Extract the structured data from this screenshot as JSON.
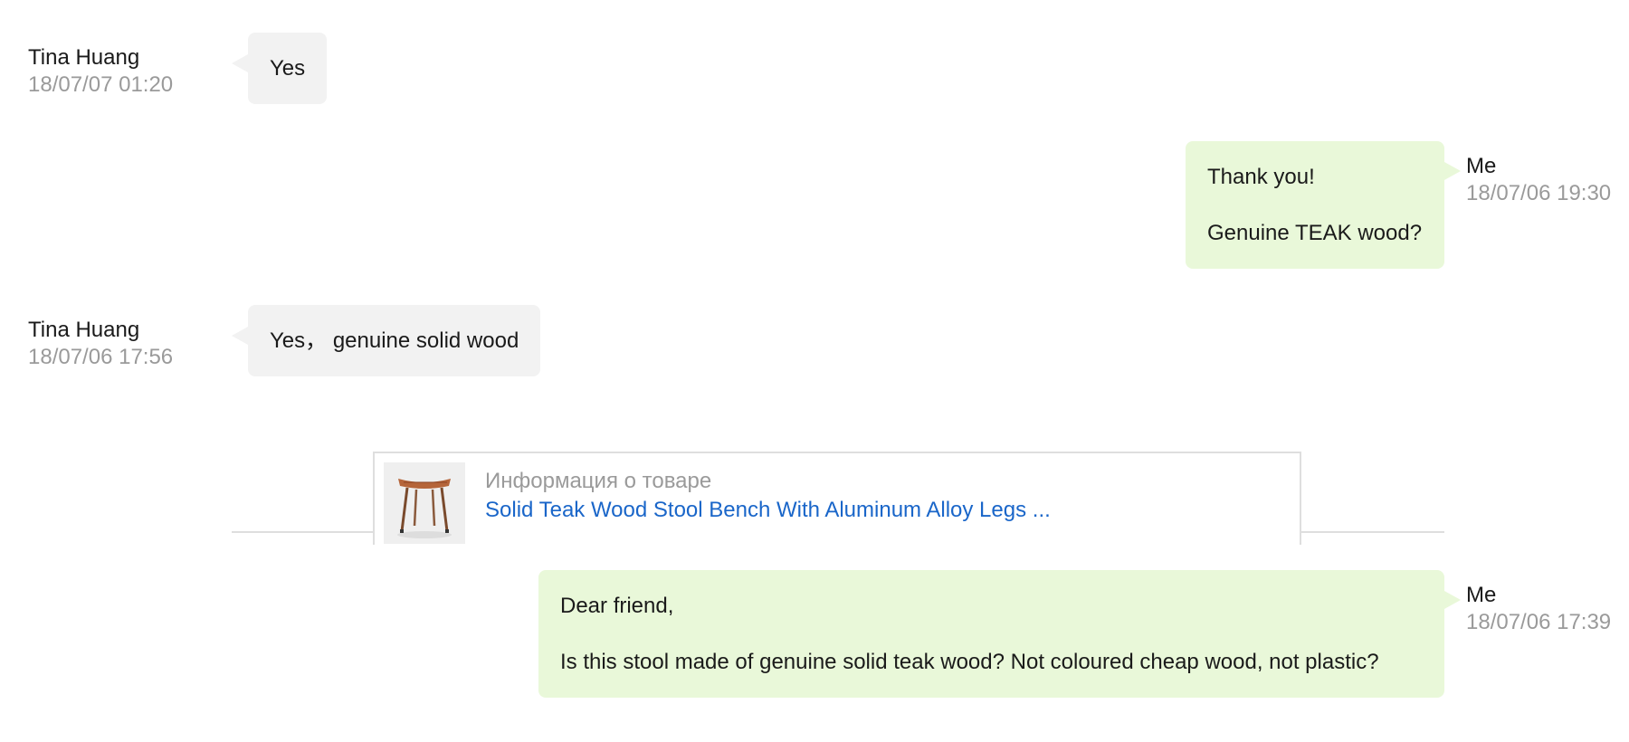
{
  "messages": [
    {
      "sender": "Tina Huang",
      "time": "18/07/07 01:20",
      "lines": [
        "Yes"
      ]
    },
    {
      "sender": "Me",
      "time": "18/07/06 19:30",
      "lines": [
        "Thank you!",
        "Genuine TEAK wood?"
      ]
    },
    {
      "sender": "Tina Huang",
      "time": "18/07/06 17:56",
      "lines": [
        "Yes， genuine solid wood"
      ]
    },
    {
      "sender": "Me",
      "time": "18/07/06 17:39",
      "lines": [
        "Dear friend,",
        "Is this stool made of genuine solid teak wood? Not coloured cheap wood, not plastic?"
      ]
    }
  ],
  "product_card": {
    "label": "Информация о товаре",
    "title": "Solid Teak Wood Stool Bench With Aluminum Alloy Legs ...",
    "thumbnail_icon": "teak-stool-image"
  },
  "colors": {
    "incoming_bubble": "#f2f2f2",
    "outgoing_bubble": "#e9f8d9",
    "link": "#1a66c9",
    "muted_text": "#9a9a9a"
  }
}
